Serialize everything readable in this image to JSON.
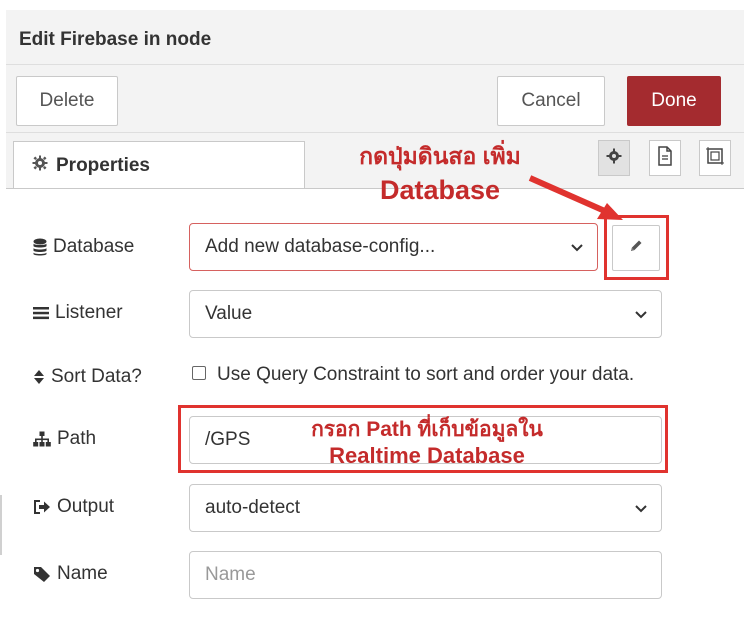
{
  "dialog": {
    "title": "Edit Firebase in node"
  },
  "toolbar": {
    "delete_label": "Delete",
    "cancel_label": "Cancel",
    "done_label": "Done"
  },
  "tabs": {
    "properties_label": "Properties"
  },
  "form": {
    "database": {
      "label": "Database",
      "value": "Add new database-config..."
    },
    "listener": {
      "label": "Listener",
      "value": "Value"
    },
    "sort": {
      "label": "Sort Data?",
      "checkbox_text": "Use Query Constraint to sort and order your data.",
      "checked": false
    },
    "path": {
      "label": "Path",
      "value": "/GPS"
    },
    "output": {
      "label": "Output",
      "value": "auto-detect"
    },
    "name": {
      "label": "Name",
      "placeholder": "Name",
      "value": ""
    }
  },
  "annotations": {
    "edit_hint_line1": "กดปุ่มดินสอ เพิ่ม",
    "edit_hint_line2": "Database",
    "path_hint_line1": "กรอก Path ที่เก็บข้อมูลใน",
    "path_hint_line2": "Realtime Database"
  },
  "colors": {
    "done_button": "#a42b2f",
    "annotation": "#c42b2b",
    "highlight_box": "#e0332f",
    "error_border": "#d6615f"
  }
}
